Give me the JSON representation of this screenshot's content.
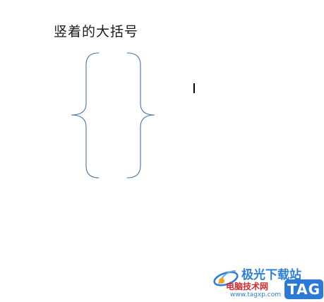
{
  "document": {
    "heading": "竖着的大括号"
  },
  "shape": {
    "type": "vertical-curly-brace",
    "stroke_color": "#4a72a6"
  },
  "watermark": {
    "site_name": "极光下载站",
    "sub_text": "电脑技术网",
    "url": "www.tagxp.com",
    "badge": "TAG",
    "colors": {
      "blue": "#2c7ad6",
      "red": "#d42a2a"
    }
  }
}
